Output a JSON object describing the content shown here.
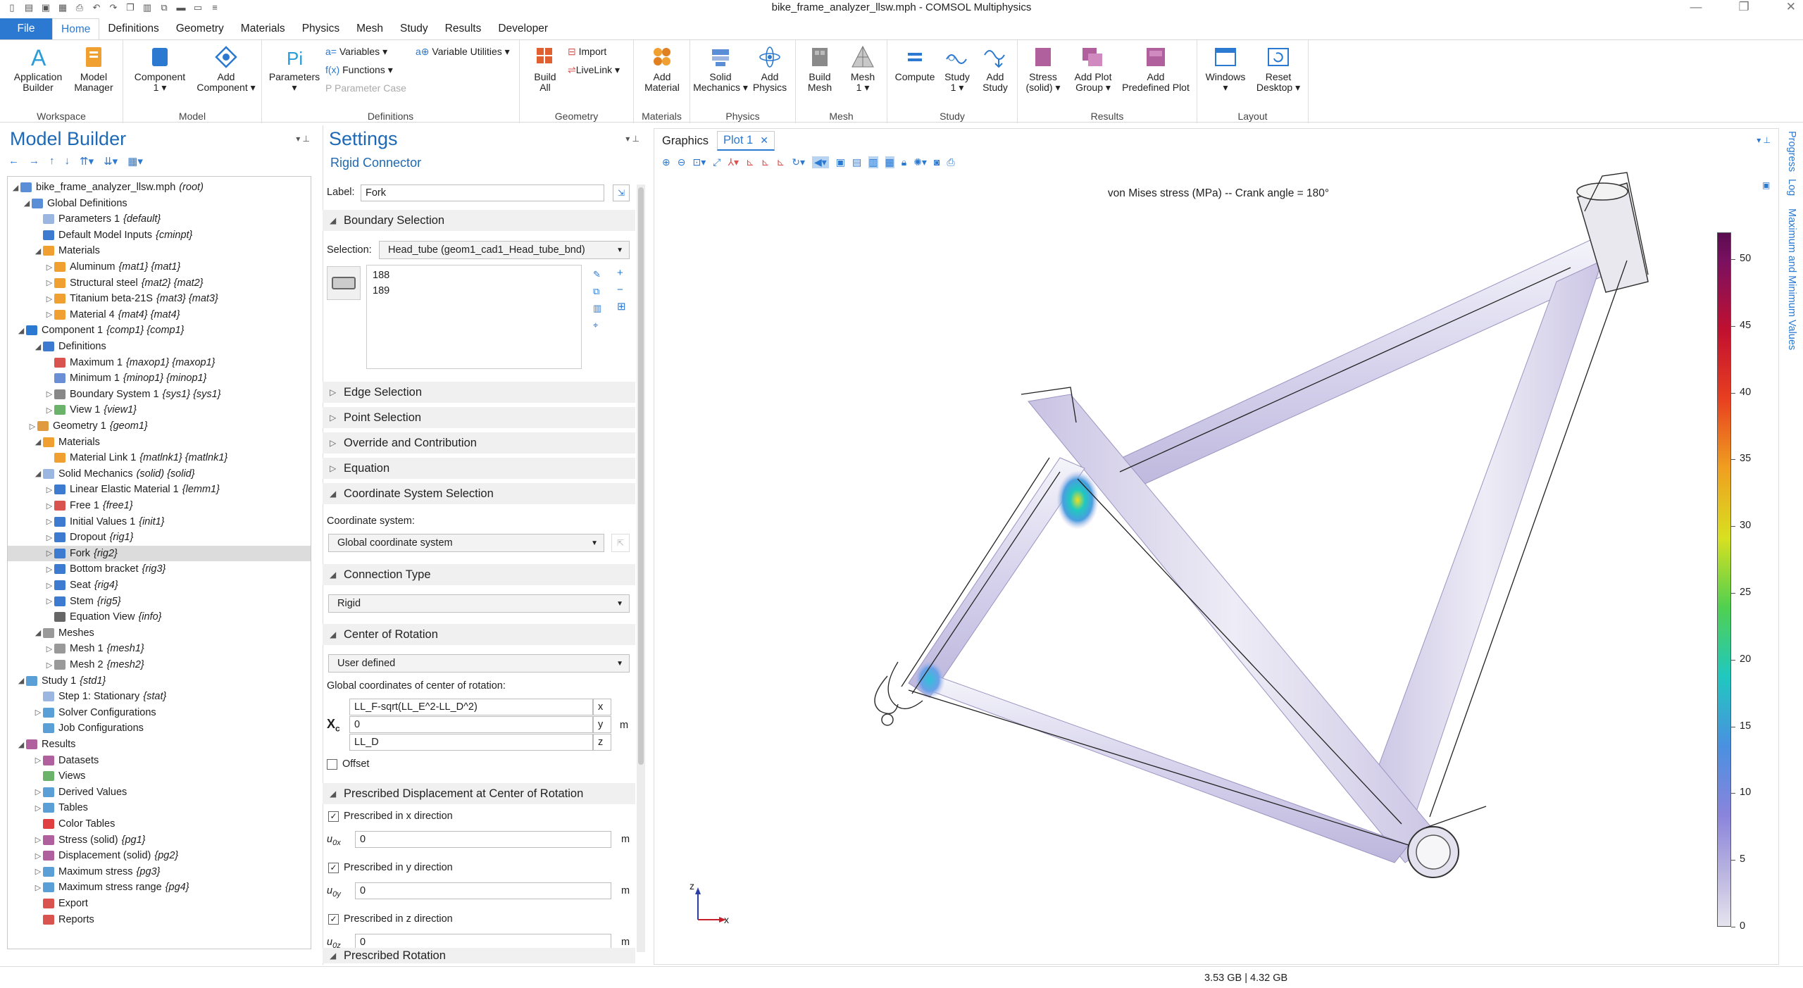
{
  "window": {
    "title": "bike_frame_analyzer_llsw.mph - COMSOL Multiphysics",
    "controls": [
      "minimize-icon",
      "restore-icon",
      "close-icon"
    ]
  },
  "quick_access": [
    "new-icon",
    "open-icon",
    "save-icon",
    "save-as-icon",
    "print-icon",
    "undo-icon",
    "redo-icon",
    "copy-icon",
    "paste-icon",
    "duplicate-icon",
    "delete-icon",
    "window-icon",
    "settings-icon"
  ],
  "menu": {
    "file": "File",
    "tabs": [
      "Home",
      "Definitions",
      "Geometry",
      "Materials",
      "Physics",
      "Mesh",
      "Study",
      "Results",
      "Developer"
    ],
    "active": "Home"
  },
  "ribbon": {
    "groups": {
      "workspace": "Workspace",
      "model": "Model",
      "definitions": "Definitions",
      "geometry": "Geometry",
      "materials": "Materials",
      "physics": "Physics",
      "mesh": "Mesh",
      "study": "Study",
      "results": "Results",
      "layout": "Layout"
    },
    "buttons": {
      "application_builder": [
        "Application",
        "Builder"
      ],
      "model_manager": [
        "Model",
        "Manager"
      ],
      "component": [
        "Component",
        "1 ▾"
      ],
      "add_component": [
        "Add",
        "Component ▾"
      ],
      "parameters": [
        "Parameters",
        "▾"
      ],
      "variables": "Variables ▾",
      "functions": "Functions ▾",
      "parameter_case": "Parameter Case",
      "variable_utilities": "Variable Utilities ▾",
      "import": "Import",
      "livelink": "LiveLink ▾",
      "build_all": [
        "Build",
        "All"
      ],
      "add_material": [
        "Add",
        "Material"
      ],
      "solid_mechanics": [
        "Solid",
        "Mechanics ▾"
      ],
      "add_physics": [
        "Add",
        "Physics"
      ],
      "build_mesh": [
        "Build",
        "Mesh"
      ],
      "mesh": [
        "Mesh",
        "1 ▾"
      ],
      "compute": [
        "Compute"
      ],
      "study": [
        "Study",
        "1 ▾"
      ],
      "add_study": [
        "Add",
        "Study"
      ],
      "stress": [
        "Stress",
        "(solid) ▾"
      ],
      "add_plot_group": [
        "Add Plot",
        "Group ▾"
      ],
      "add_predefined_plot": [
        "Add",
        "Predefined Plot"
      ],
      "windows": [
        "Windows",
        "▾"
      ],
      "reset_desktop": [
        "Reset",
        "Desktop ▾"
      ]
    }
  },
  "model_builder": {
    "title": "Model Builder",
    "toolbar_icons": [
      "back-icon",
      "forward-icon",
      "up-icon",
      "down-icon",
      "show-icon",
      "collapse-icon",
      "expand-icon"
    ],
    "tree": [
      {
        "label": "bike_frame_analyzer_llsw.mph",
        "tag": "(root)",
        "depth": 0,
        "exp": "◢",
        "color": "#5a8ed6"
      },
      {
        "label": "Global Definitions",
        "tag": "",
        "depth": 1,
        "exp": "◢",
        "color": "#5a8ed6"
      },
      {
        "label": "Parameters 1",
        "tag": "{default}",
        "depth": 2,
        "exp": "",
        "color": "#9bb6e0"
      },
      {
        "label": "Default Model Inputs",
        "tag": "{cminpt}",
        "depth": 2,
        "exp": "",
        "color": "#3d7bd1"
      },
      {
        "label": "Materials",
        "tag": "",
        "depth": 2,
        "exp": "◢",
        "color": "#f0a030"
      },
      {
        "label": "Aluminum",
        "tag": "{mat1} {mat1}",
        "depth": 3,
        "exp": "▷",
        "color": "#f0a030"
      },
      {
        "label": "Structural steel",
        "tag": "{mat2} {mat2}",
        "depth": 3,
        "exp": "▷",
        "color": "#f0a030"
      },
      {
        "label": "Titanium beta-21S",
        "tag": "{mat3} {mat3}",
        "depth": 3,
        "exp": "▷",
        "color": "#f0a030"
      },
      {
        "label": "Material 4",
        "tag": "{mat4} {mat4}",
        "depth": 3,
        "exp": "▷",
        "color": "#f0a030"
      },
      {
        "label": "Component 1",
        "tag": "{comp1} {comp1}",
        "depth": 0.5,
        "exp": "◢",
        "color": "#2b79d0"
      },
      {
        "label": "Definitions",
        "tag": "",
        "depth": 2,
        "exp": "◢",
        "color": "#3d7bd1"
      },
      {
        "label": "Maximum 1",
        "tag": "{maxop1} {maxop1}",
        "depth": 3,
        "exp": "",
        "color": "#d9534f"
      },
      {
        "label": "Minimum 1",
        "tag": "{minop1} {minop1}",
        "depth": 3,
        "exp": "",
        "color": "#6b8fd6"
      },
      {
        "label": "Boundary System 1",
        "tag": "{sys1} {sys1}",
        "depth": 3,
        "exp": "▷",
        "color": "#888"
      },
      {
        "label": "View 1",
        "tag": "{view1}",
        "depth": 3,
        "exp": "▷",
        "color": "#6bb36b"
      },
      {
        "label": "Geometry 1",
        "tag": "{geom1}",
        "depth": 1.5,
        "exp": "▷",
        "color": "#e09a40"
      },
      {
        "label": "Materials",
        "tag": "",
        "depth": 2,
        "exp": "◢",
        "color": "#f0a030"
      },
      {
        "label": "Material Link 1",
        "tag": "{matlnk1} {matlnk1}",
        "depth": 3,
        "exp": "",
        "color": "#f0a030"
      },
      {
        "label": "Solid Mechanics",
        "tag": "(solid) {solid}",
        "depth": 2,
        "exp": "◢",
        "color": "#9bb6e0"
      },
      {
        "label": "Linear Elastic Material 1",
        "tag": "{lemm1}",
        "depth": 3,
        "exp": "▷",
        "color": "#3d7bd1"
      },
      {
        "label": "Free 1",
        "tag": "{free1}",
        "depth": 3,
        "exp": "▷",
        "color": "#d9534f"
      },
      {
        "label": "Initial Values 1",
        "tag": "{init1}",
        "depth": 3,
        "exp": "▷",
        "color": "#3d7bd1"
      },
      {
        "label": "Dropout",
        "tag": "{rig1}",
        "depth": 3,
        "exp": "▷",
        "color": "#3d7bd1"
      },
      {
        "label": "Fork",
        "tag": "{rig2}",
        "depth": 3,
        "exp": "▷",
        "color": "#3d7bd1",
        "selected": true
      },
      {
        "label": "Bottom bracket",
        "tag": "{rig3}",
        "depth": 3,
        "exp": "▷",
        "color": "#3d7bd1"
      },
      {
        "label": "Seat",
        "tag": "{rig4}",
        "depth": 3,
        "exp": "▷",
        "color": "#3d7bd1"
      },
      {
        "label": "Stem",
        "tag": "{rig5}",
        "depth": 3,
        "exp": "▷",
        "color": "#3d7bd1"
      },
      {
        "label": "Equation View",
        "tag": "{info}",
        "depth": 3,
        "exp": "",
        "color": "#666"
      },
      {
        "label": "Meshes",
        "tag": "",
        "depth": 2,
        "exp": "◢",
        "color": "#999"
      },
      {
        "label": "Mesh 1",
        "tag": "{mesh1}",
        "depth": 3,
        "exp": "▷",
        "color": "#999"
      },
      {
        "label": "Mesh 2",
        "tag": "{mesh2}",
        "depth": 3,
        "exp": "▷",
        "color": "#999"
      },
      {
        "label": "Study 1",
        "tag": "{std1}",
        "depth": 0.5,
        "exp": "◢",
        "color": "#5aa0d6"
      },
      {
        "label": "Step 1: Stationary",
        "tag": "{stat}",
        "depth": 2,
        "exp": "",
        "color": "#9bb6e0"
      },
      {
        "label": "Solver Configurations",
        "tag": "",
        "depth": 2,
        "exp": "▷",
        "color": "#5aa0d6"
      },
      {
        "label": "Job Configurations",
        "tag": "",
        "depth": 2,
        "exp": "",
        "color": "#5aa0d6"
      },
      {
        "label": "Results",
        "tag": "",
        "depth": 0.5,
        "exp": "◢",
        "color": "#b0609c"
      },
      {
        "label": "Datasets",
        "tag": "",
        "depth": 2,
        "exp": "▷",
        "color": "#b0609c"
      },
      {
        "label": "Views",
        "tag": "",
        "depth": 2,
        "exp": "",
        "color": "#6bb36b"
      },
      {
        "label": "Derived Values",
        "tag": "",
        "depth": 2,
        "exp": "▷",
        "color": "#5aa0d6"
      },
      {
        "label": "Tables",
        "tag": "",
        "depth": 2,
        "exp": "▷",
        "color": "#5aa0d6"
      },
      {
        "label": "Color Tables",
        "tag": "",
        "depth": 2,
        "exp": "",
        "color": "#e04040"
      },
      {
        "label": "Stress (solid)",
        "tag": "{pg1}",
        "depth": 2,
        "exp": "▷",
        "color": "#b0609c"
      },
      {
        "label": "Displacement (solid)",
        "tag": "{pg2}",
        "depth": 2,
        "exp": "▷",
        "color": "#b0609c"
      },
      {
        "label": "Maximum stress",
        "tag": "{pg3}",
        "depth": 2,
        "exp": "▷",
        "color": "#5aa0d6"
      },
      {
        "label": "Maximum stress range",
        "tag": "{pg4}",
        "depth": 2,
        "exp": "▷",
        "color": "#5aa0d6"
      },
      {
        "label": "Export",
        "tag": "",
        "depth": 2,
        "exp": "",
        "color": "#d9534f"
      },
      {
        "label": "Reports",
        "tag": "",
        "depth": 2,
        "exp": "",
        "color": "#d9534f"
      }
    ]
  },
  "settings": {
    "title": "Settings",
    "subtitle": "Rigid Connector",
    "label_caption": "Label:",
    "label_value": "Fork",
    "sections": {
      "boundary": "Boundary Selection",
      "edge": "Edge Selection",
      "point": "Point Selection",
      "override": "Override and Contribution",
      "equation": "Equation",
      "coord": "Coordinate System Selection",
      "connection": "Connection Type",
      "center": "Center of Rotation",
      "prescribed_disp": "Prescribed Displacement at Center of Rotation",
      "prescribed_rot": "Prescribed Rotation"
    },
    "selection_caption": "Selection:",
    "selection_value": "Head_tube (geom1_cad1_Head_tube_bnd)",
    "selection_items": [
      "188",
      "189"
    ],
    "coord_caption": "Coordinate system:",
    "coord_value": "Global coordinate system",
    "connection_value": "Rigid",
    "center_value": "User defined",
    "center_caption": "Global coordinates of center of rotation:",
    "xc_symbol": "X",
    "xc_sub": "c",
    "xc_rows": [
      {
        "value": "LL_F-sqrt(LL_E^2-LL_D^2)",
        "comp": "x"
      },
      {
        "value": "0",
        "comp": "y"
      },
      {
        "value": "LL_D",
        "comp": "z"
      }
    ],
    "unit_m": "m",
    "offset_label": "Offset",
    "prescribed": [
      {
        "label": "Prescribed in x direction",
        "sym": "u",
        "sub": "0x",
        "value": "0"
      },
      {
        "label": "Prescribed in y direction",
        "sym": "u",
        "sub": "0y",
        "value": "0"
      },
      {
        "label": "Prescribed in z direction",
        "sym": "u",
        "sub": "0z",
        "value": "0"
      }
    ]
  },
  "graphics": {
    "tabs": [
      "Graphics",
      "Plot 1"
    ],
    "plot_title": "von Mises stress (MPa) -- Crank angle = 180°",
    "axis_labels": {
      "z": "z",
      "x": "x"
    },
    "colorbar": {
      "ticks": [
        "0",
        "5",
        "10",
        "15",
        "20",
        "25",
        "30",
        "35",
        "40",
        "45",
        "50"
      ],
      "min": 0,
      "max": 52
    }
  },
  "side_tabs": [
    "Progress",
    "Log",
    "Maximum and Minimum Values"
  ],
  "status": {
    "memory": "3.53 GB | 4.32 GB"
  }
}
